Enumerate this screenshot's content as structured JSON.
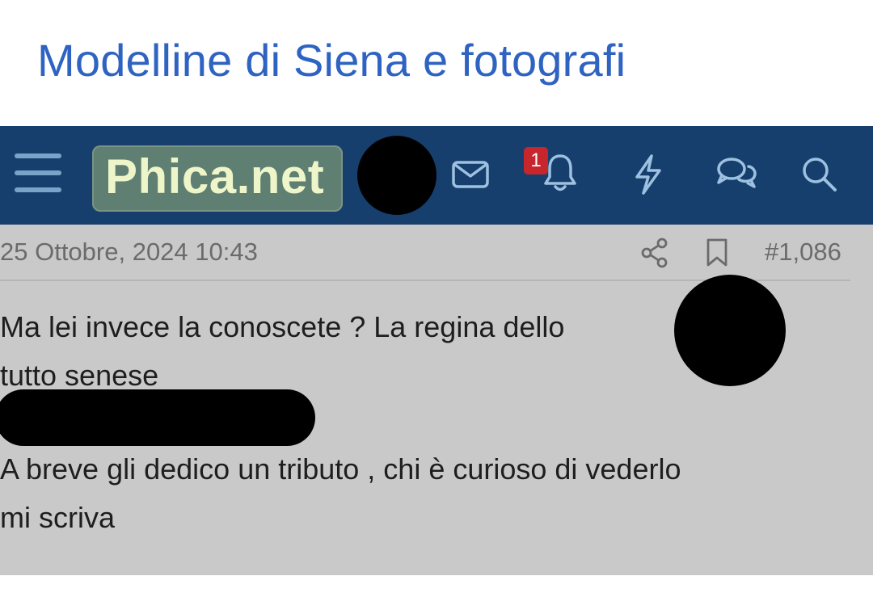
{
  "headline": "Modelline di Siena e fotografi",
  "navbar": {
    "logo_text": "Phica.net",
    "notification_count": "1",
    "icons": [
      "menu-icon",
      "mail-icon",
      "bell-icon",
      "lightning-icon",
      "chat-bubbles-icon",
      "search-icon"
    ]
  },
  "post": {
    "date": "25 Ottobre, 2024 10:43",
    "number": "#1,086",
    "lines": [
      "Ma lei invece la conoscete ? La regina dello",
      "tutto senese",
      "A breve gli dedico un tributo , chi è curioso di vederlo",
      "mi scriva"
    ]
  },
  "colors": {
    "headline": "#2f63c2",
    "navbar": "#163f6e",
    "logo_bg": "#5f7f73",
    "logo_text": "#eef5c8",
    "badge": "#c8262d",
    "post_bg": "#c9c9c9"
  }
}
